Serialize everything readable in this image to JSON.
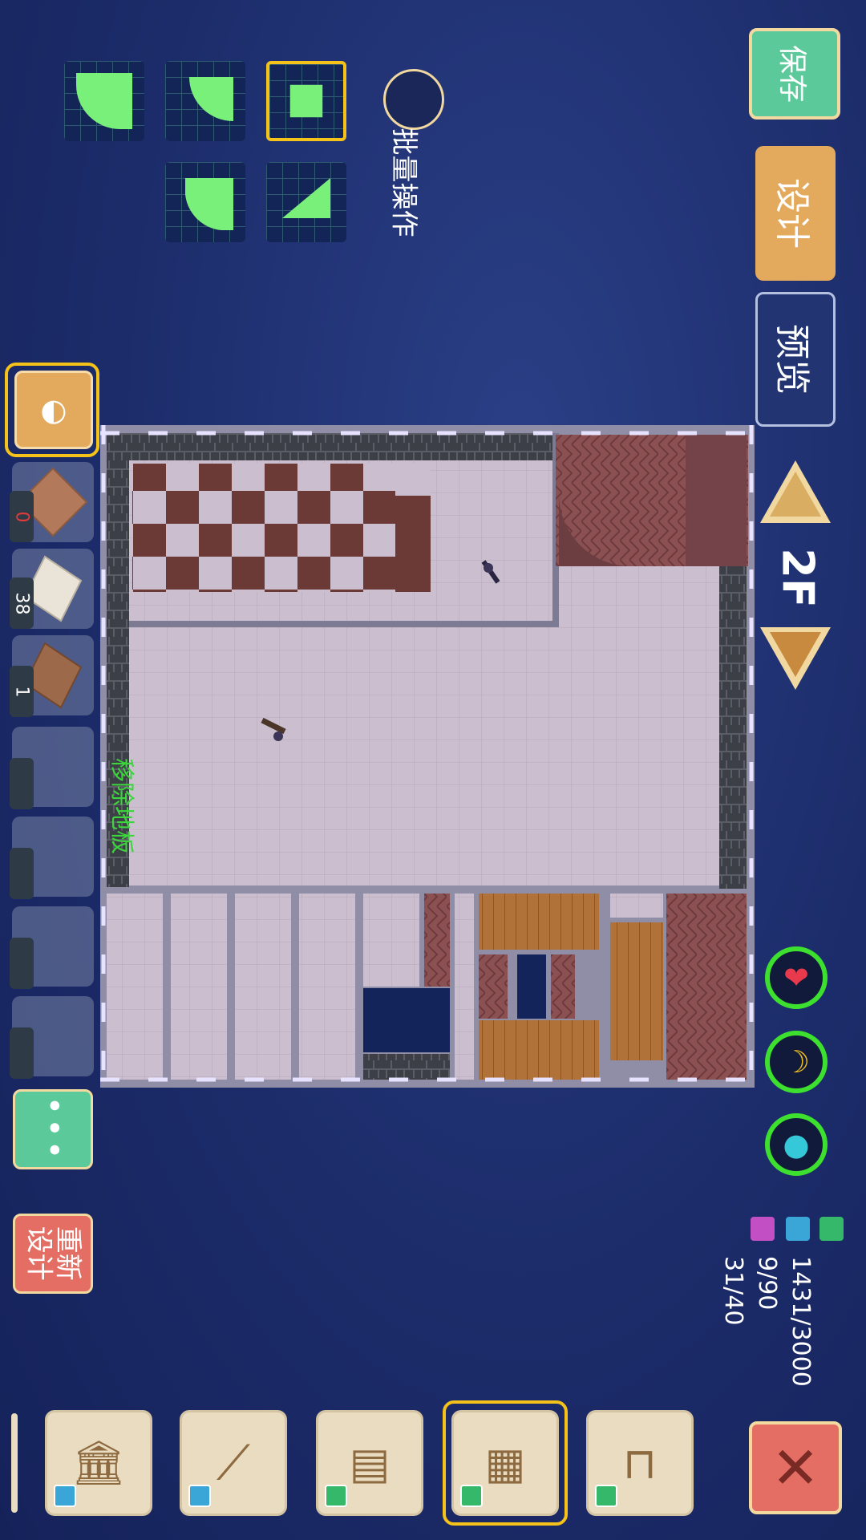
{
  "header": {
    "save_label": "保存",
    "design_label": "设计",
    "preview_label": "预览",
    "floor": "2F"
  },
  "brush": {
    "batch_label": "批量操作",
    "shapes": [
      "quarter-round-large",
      "quarter-round-small-tl",
      "square-fill",
      "quarter-round-small-bl",
      "triangle"
    ]
  },
  "map": {
    "remove_floor_label": "移除地板"
  },
  "inventory": {
    "slots": [
      {
        "name": "brick-diamond-tile",
        "count": "0"
      },
      {
        "name": "white-stone-tile",
        "count": "38"
      },
      {
        "name": "wood-plank-tile",
        "count": "1"
      },
      {
        "name": "empty",
        "count": ""
      },
      {
        "name": "empty",
        "count": ""
      },
      {
        "name": "empty",
        "count": ""
      },
      {
        "name": "empty",
        "count": ""
      }
    ],
    "more_icon": "more-dots-icon",
    "redesign_label": "重新设计"
  },
  "stats": {
    "gauges": [
      {
        "icon": "heart-icon",
        "color": "#e8394d"
      },
      {
        "icon": "banana-icon",
        "color": "#f1c21a"
      },
      {
        "icon": "drop-icon",
        "color": "#35c8d8"
      }
    ],
    "resources": [
      {
        "color": "#35b86a",
        "value": "1431/3000"
      },
      {
        "color": "#3aa6d8",
        "value": "9/90"
      },
      {
        "color": "#c24fc4",
        "value": "31/40"
      }
    ]
  },
  "categories": [
    {
      "icon": "pillar-icon",
      "tag_color": "#3aa6d8"
    },
    {
      "icon": "stairs-icon",
      "tag_color": "#3aa6d8"
    },
    {
      "icon": "wall-icon",
      "tag_color": "#35b86a"
    },
    {
      "icon": "floor-icon",
      "tag_color": "#35b86a",
      "selected": true
    },
    {
      "icon": "furniture-icon",
      "tag_color": "#35b86a"
    }
  ],
  "close_icon": "close-icon"
}
